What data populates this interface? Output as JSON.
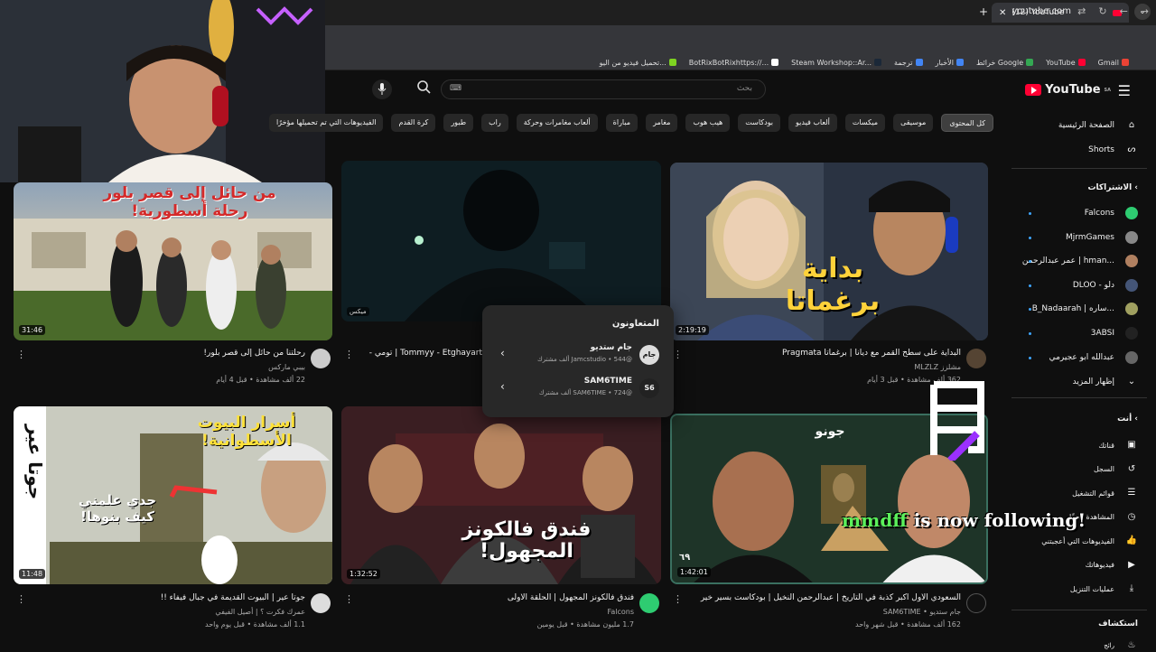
{
  "browser": {
    "tab_title": "(12) YouTube",
    "url": "youtube.com",
    "bookmarks": [
      {
        "label": "Gmail",
        "color": "#ea4335"
      },
      {
        "label": "YouTube",
        "color": "#ff0033"
      },
      {
        "label": "خرائط Google",
        "color": "#34a853"
      },
      {
        "label": "الأخبار",
        "color": "#4285f4"
      },
      {
        "label": "ترجمة",
        "color": "#4285f4"
      },
      {
        "label": "Steam Workshop::Ar...",
        "color": "#1b2838"
      },
      {
        "label": "BotRixBotRixhttps://...",
        "color": "#ffffff"
      },
      {
        "label": "تحميل فيديو من اليو...",
        "color": "#7ed321"
      }
    ]
  },
  "header": {
    "logo_text": "YouTube",
    "logo_region": "SA",
    "search_placeholder": "بحث"
  },
  "chips": [
    "كل المحتوى",
    "موسيقى",
    "ميكسات",
    "ألعاب فيديو",
    "بودكاست",
    "هيب هوب",
    "مغامر",
    "مباراة",
    "ألعاب مغامرات وحركة",
    "راب",
    "طبور",
    "كرة القدم",
    "الفيديوهات التي تم تحميلها مؤخرًا"
  ],
  "sidebar": {
    "home": "الصفحة الرئيسية",
    "shorts": "Shorts",
    "subscriptions_head": "الاشتراكات",
    "subscriptions": [
      {
        "name": "Falcons",
        "color": "#2ecc71"
      },
      {
        "name": "MjrmGames",
        "color": "#888888"
      },
      {
        "name": "عمر عبدالرحمن | hman...",
        "color": "#b08060"
      },
      {
        "name": "DLOO - دلو",
        "color": "#445577"
      },
      {
        "name": "B_Nadaarah | ساره...",
        "color": "#a0a060"
      },
      {
        "name": "3ABSI",
        "color": "#222222"
      },
      {
        "name": "عبدالله ابو عجيرمي",
        "color": "#666666"
      }
    ],
    "show_more": "إظهار المزيد",
    "you_head": "أنت",
    "you_items": [
      "قناتك",
      "السجل",
      "قوائم التشغيل",
      "المشاهدة لاحقًا",
      "الفيديوهات التي أعجبتني",
      "فيديوهاتك",
      "عمليات التنزيل"
    ],
    "explore_head": "استكشاف",
    "explore_first": "رائج"
  },
  "videos": [
    {
      "title": "رحلتنا من حائل إلى قصر بلور!",
      "channel": "بيبي ماركس",
      "meta": "22 ألف مشاهدة • قبل 4 أيام",
      "duration": "31:46",
      "thumb_text": "من حائل إلى قصر بلور رحلة أسطورية!"
    },
    {
      "title": "Tommyy - Etghayart | تومي -",
      "channel": "",
      "meta": "",
      "duration": "",
      "mix_label": "ميكس"
    },
    {
      "title": "البداية على سطح القمر مع ديانا | برغماتا Pragmata",
      "channel": "مشلزز MLZLZ",
      "meta": "362 ألف مشاهدة • قبل 3 أيام",
      "duration": "2:19:19",
      "thumb_text": "بداية برغماتا"
    },
    {
      "title": "جوتا عير | البيوت القديمة في جبال فيفاء !!",
      "channel": "عمرك فكرت ؟ | أصيل الفيفي",
      "meta": "1.1 ألف مشاهدة • قبل يوم واحد",
      "duration": "11:48",
      "thumb_text": "أسرار البيوت الأسطوانية!",
      "side_text": "جوتا عير",
      "sub_text": "جدي علمني كيف بنوها!"
    },
    {
      "title": "فندق فالكونز المجهول | الحلقة الاولى",
      "channel": "Falcons",
      "meta": "1.7 مليون مشاهدة • قبل يومين",
      "duration": "1:32:52",
      "thumb_text": "فندق فالكونز المجهول!"
    },
    {
      "title": "السعودي الأول أكبر كذبة في التاريخ | عبدالرحمن النخيل | بودكاست بسير خير",
      "channel": "SAM6TIME",
      "channel_prefix": "جام ستديو",
      "meta": "162 ألف مشاهدة • قبل شهر واحد",
      "duration": "1:42:01",
      "thumb_text": "جونو",
      "badge_num": "٦٩"
    }
  ],
  "collaborators": {
    "title": "المتعاونون",
    "items": [
      {
        "name": "جام ستديو",
        "sub": "@Jamcstudio • 544 ألف مشترك",
        "avatar": "جام"
      },
      {
        "name": "SAM6TIME",
        "sub": "@SAM6TIME • 724 ألف مشترك",
        "avatar": "S6"
      }
    ]
  },
  "overlay": {
    "username": "mmdff",
    "message": " is now following!"
  },
  "colors": {
    "bg": "#0f0f0f",
    "accent": "#ff0033",
    "follow_name": "#5bf05b"
  }
}
